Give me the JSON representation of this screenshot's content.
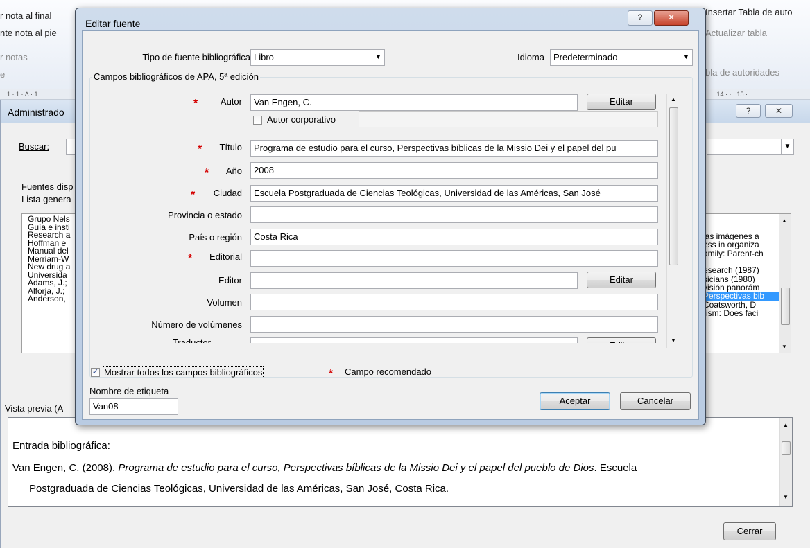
{
  "ribbon": {
    "items": [
      "r nota al final",
      "nte nota al pie",
      "r notas",
      "e"
    ],
    "right_items": [
      "Insertar Tabla de auto",
      "Actualizar tabla",
      "bla de autoridades"
    ],
    "ruler_left": "1 · 1 · ∆ · 1",
    "ruler_right": "· 14 · · · 15 ·"
  },
  "admin": {
    "title": "Administrado",
    "search_label": "Buscar:",
    "sources_label": "Fuentes disp",
    "master_list_label": "Lista genera",
    "list_left": [
      "Grupo Nels",
      "Guía e insti",
      "Research a",
      "Hoffman e",
      "Manual del",
      "Merriam-W",
      "New drug a",
      "Universida",
      "Adams, J.;",
      "Alforja, J.;",
      "Anderson,"
    ],
    "list_right": [
      "las imágenes a",
      "ess in organiza",
      "amily: Parent-ch",
      "esearch (1987)",
      "sicians (1980)",
      "visión panorám",
      "Perspectivas bib",
      "Coatsworth, D",
      "-ism: Does faci"
    ],
    "preview_label": "Vista previa (A",
    "preview_heading": "Entrada bibliográfica:",
    "preview_prefix": "Van Engen, C. (2008).",
    "preview_title": "Programa de estudio para el curso, Perspectivas bíblicas de la Missio Dei y el papel del pueblo de Dios",
    "preview_suffix": ". Escuela",
    "preview_line2": "Postgraduada de Ciencias Teológicas, Universidad de las Américas, San José, Costa Rica.",
    "close_button": "Cerrar",
    "help_glyph": "?",
    "close_glyph": "✕"
  },
  "dialog": {
    "title": "Editar fuente",
    "source_type_label": "Tipo de fuente bibliográfica",
    "source_type_value": "Libro",
    "language_label": "Idioma",
    "language_value": "Predeterminado",
    "group_label": "Campos bibliográficos de APA, 5ª edición",
    "author_label": "Autor",
    "author_value": "Van Engen, C.",
    "edit_button": "Editar",
    "corporate_author_label": "Autor corporativo",
    "title_label": "Título",
    "title_value": "Programa de estudio para el curso, Perspectivas bíblicas de la Missio Dei y el papel del pu",
    "year_label": "Año",
    "year_value": "2008",
    "city_label": "Ciudad",
    "city_value": "Escuela Postgraduada de Ciencias Teológicas, Universidad de las Américas, San José",
    "state_label": "Provincia o estado",
    "state_value": "",
    "country_label": "País o región",
    "country_value": "Costa Rica",
    "publisher_label": "Editorial",
    "publisher_value": "",
    "editor_label": "Editor",
    "editor_value": "",
    "volume_label": "Volumen",
    "volume_value": "",
    "num_volumes_label": "Número de volúmenes",
    "num_volumes_value": "",
    "translator_label": "Traductor",
    "show_all_label": "Mostrar todos los campos bibliográficos",
    "show_all_checked": "✓",
    "recommended_label": "Campo recomendado",
    "tag_name_label": "Nombre de etiqueta",
    "tag_name_value": "Van08",
    "ok_button": "Aceptar",
    "cancel_button": "Cancelar",
    "help_glyph": "?",
    "close_glyph": "✕",
    "star": "*"
  }
}
